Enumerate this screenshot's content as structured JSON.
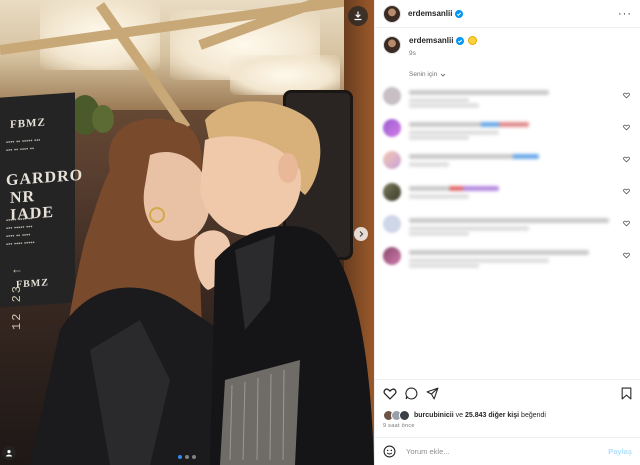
{
  "post": {
    "author": "erdemsanlii",
    "caption_emoji": "grinning-face-emoji",
    "posted_ago_short": "9s",
    "translation_label": "Senin için",
    "photo_timestamp": "12 23 ↑",
    "likes": {
      "liked_by": "burcubinicii",
      "connector": "ve",
      "others_count": "25.843",
      "others_label": "diğer kişi",
      "suffix": "beğendi"
    },
    "posted_ago_long": "9 saat önce",
    "add_comment_placeholder": "Yorum ekle...",
    "post_button": "Paylaş",
    "carousel": {
      "count": 3,
      "active": 1
    }
  },
  "colors": {
    "verified": "#0095f6",
    "link": "#b2dffc",
    "muted": "#737373"
  },
  "comments_note_blurred": true
}
